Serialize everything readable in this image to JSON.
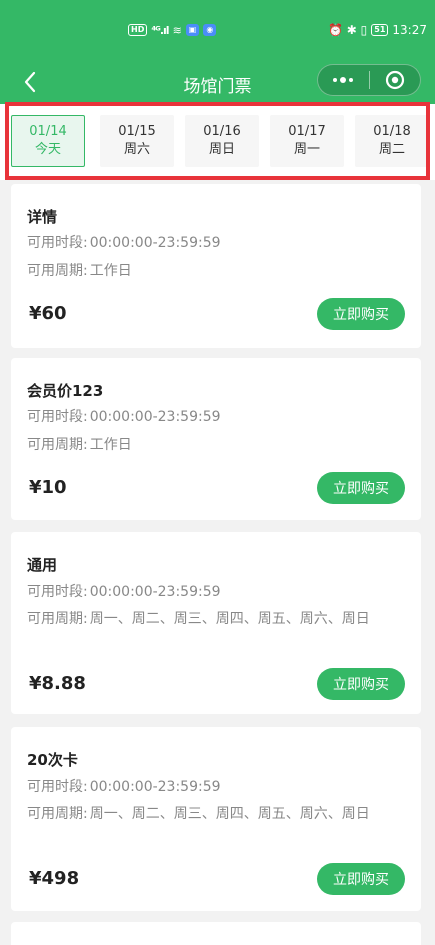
{
  "status_bar": {
    "hd_badge": "HD",
    "network": "⁴ᴳ.ıl",
    "wifi": "≋",
    "right_icons": "⏰ ✱ ▯",
    "battery": "51",
    "time": "13:27"
  },
  "nav": {
    "title": "场馆门票"
  },
  "dates": [
    {
      "date": "01/14",
      "day": "今天"
    },
    {
      "date": "01/15",
      "day": "周六"
    },
    {
      "date": "01/16",
      "day": "周日"
    },
    {
      "date": "01/17",
      "day": "周一"
    },
    {
      "date": "01/18",
      "day": "周二"
    }
  ],
  "cards": [
    {
      "title": "详情",
      "time_label": "可用时段:",
      "time_value": "00:00:00-23:59:59",
      "period_label": "可用周期:",
      "period_value": "工作日",
      "price": "¥60",
      "buy_label": "立即购买"
    },
    {
      "title": "会员价123",
      "time_label": "可用时段:",
      "time_value": "00:00:00-23:59:59",
      "period_label": "可用周期:",
      "period_value": "工作日",
      "price": "¥10",
      "buy_label": "立即购买"
    },
    {
      "title": "通用",
      "time_label": "可用时段:",
      "time_value": "00:00:00-23:59:59",
      "period_label": "可用周期:",
      "period_value": "周一、周二、周三、周四、周五、周六、周日",
      "price": "¥8.88",
      "buy_label": "立即购买"
    },
    {
      "title": "20次卡",
      "time_label": "可用时段:",
      "time_value": "00:00:00-23:59:59",
      "period_label": "可用周期:",
      "period_value": "周一、周二、周三、周四、周五、周六、周日",
      "price": "¥498",
      "buy_label": "立即购买"
    }
  ],
  "colors": {
    "brand_green": "#34b866",
    "highlight_red": "#e8333a"
  }
}
